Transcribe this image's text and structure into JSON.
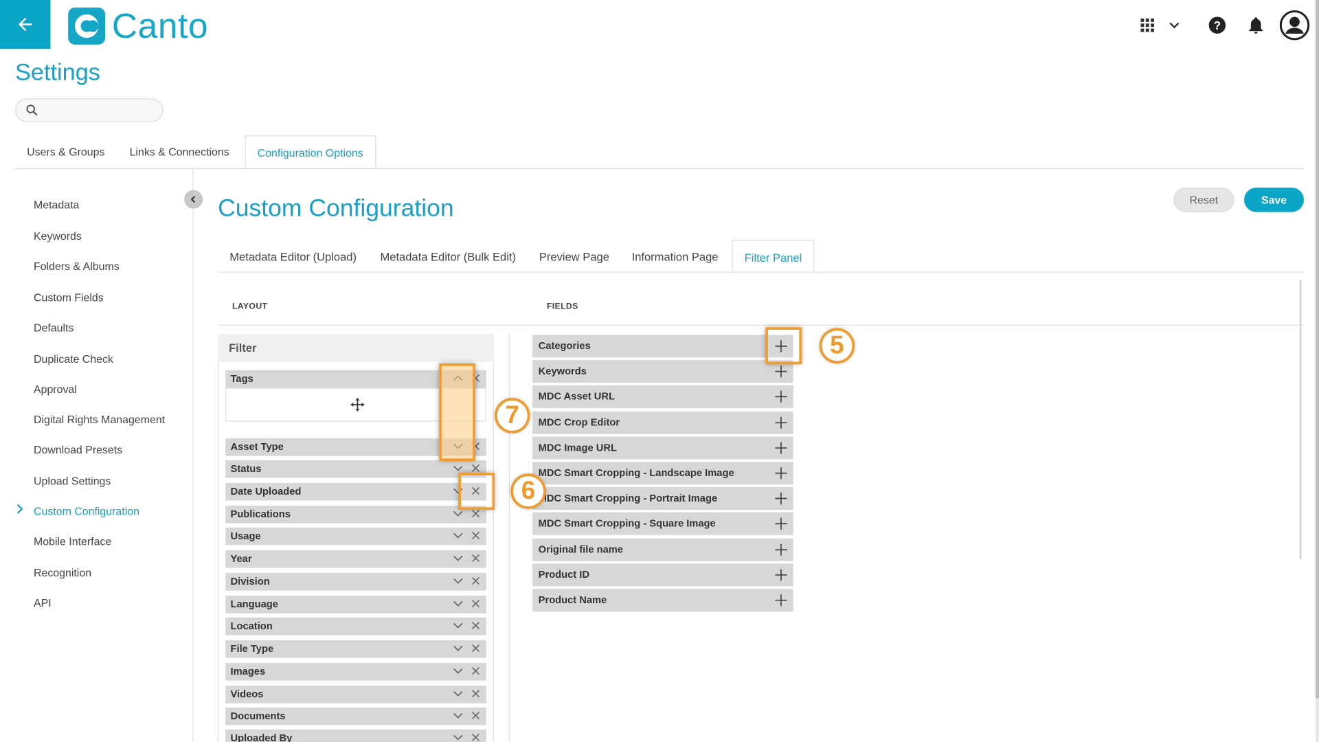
{
  "app": {
    "logo_text": "Canto",
    "brand_color": "#1aa0c5"
  },
  "header": {
    "icons": [
      "back-arrow-icon",
      "apps-grid-icon",
      "chevron-down-icon",
      "help-icon",
      "bell-icon",
      "user-avatar-icon"
    ]
  },
  "page": {
    "title": "Settings"
  },
  "search": {
    "placeholder": "",
    "value": ""
  },
  "top_tabs": [
    {
      "label": "Users & Groups",
      "active": false
    },
    {
      "label": "Links & Connections",
      "active": false
    },
    {
      "label": "Configuration Options",
      "active": true
    }
  ],
  "left_nav": [
    {
      "label": "Metadata"
    },
    {
      "label": "Keywords"
    },
    {
      "label": "Folders & Albums"
    },
    {
      "label": "Custom Fields"
    },
    {
      "label": "Defaults"
    },
    {
      "label": "Duplicate Check"
    },
    {
      "label": "Approval"
    },
    {
      "label": "Digital Rights Management"
    },
    {
      "label": "Download Presets"
    },
    {
      "label": "Upload Settings"
    },
    {
      "label": "Custom Configuration",
      "active": true
    },
    {
      "label": "Mobile Interface"
    },
    {
      "label": "Recognition"
    },
    {
      "label": "API"
    }
  ],
  "content": {
    "title": "Custom Configuration",
    "reset_label": "Reset",
    "save_label": "Save",
    "sub_tabs": [
      {
        "label": "Metadata Editor (Upload)"
      },
      {
        "label": "Metadata Editor (Bulk Edit)"
      },
      {
        "label": "Preview Page"
      },
      {
        "label": "Information Page"
      },
      {
        "label": "Filter Panel",
        "active": true
      }
    ],
    "layout_label": "LAYOUT",
    "fields_label": "FIELDS",
    "filter_heading": "Filter",
    "layout_rows": [
      "Tags",
      "Asset Type",
      "Status",
      "Date Uploaded",
      "Publications",
      "Usage",
      "Year",
      "Division",
      "Language",
      "Location",
      "File Type",
      "Images",
      "Videos",
      "Documents",
      "Uploaded By"
    ],
    "fields_rows": [
      "Categories",
      "Keywords",
      "MDC Asset URL",
      "MDC Crop Editor",
      "MDC Image URL",
      "MDC Smart Cropping - Landscape Image",
      "MDC Smart Cropping - Portrait Image",
      "MDC Smart Cropping - Square Image",
      "Original file name",
      "Product ID",
      "Product Name"
    ]
  },
  "callouts": [
    {
      "number": "5",
      "target": "add-field-button"
    },
    {
      "number": "6",
      "target": "remove-row-button"
    },
    {
      "number": "7",
      "target": "move-up-down-buttons"
    }
  ],
  "colors": {
    "accent": "#0ba5c7",
    "callout": "#ef9a2d",
    "row_bg": "#d7d7d7"
  }
}
